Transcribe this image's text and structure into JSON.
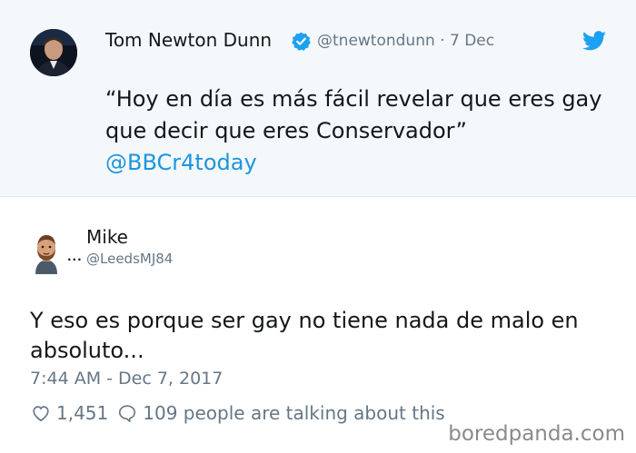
{
  "quoted_tweet": {
    "author_name": "Tom Newton Dunn",
    "handle": "@tnewtondunn",
    "separator": "·",
    "date": "7 Dec",
    "text": "“Hoy en día es más fácil revelar que eres gay que decir que eres Conservador”",
    "link": "@BBCr4today",
    "icons": [
      "verified-badge-icon",
      "twitter-bird-icon"
    ],
    "colors": {
      "background": "#f5f8fa",
      "link": "#1b95e0",
      "verified": "#1da1f2",
      "bird": "#1da1f2"
    }
  },
  "reply_tweet": {
    "author_name": "Mike",
    "handle": "@LeedsMJ84",
    "avatar_dots": "...",
    "text": "Y eso es porque ser gay no tiene nada de malo en absoluto...",
    "timestamp": "7:44 AM - Dec 7, 2017",
    "likes": "1,451",
    "talking": "109 people are talking about this",
    "icons": [
      "heart-icon",
      "chat-bubble-icon"
    ]
  },
  "watermark": "boredpanda.com"
}
